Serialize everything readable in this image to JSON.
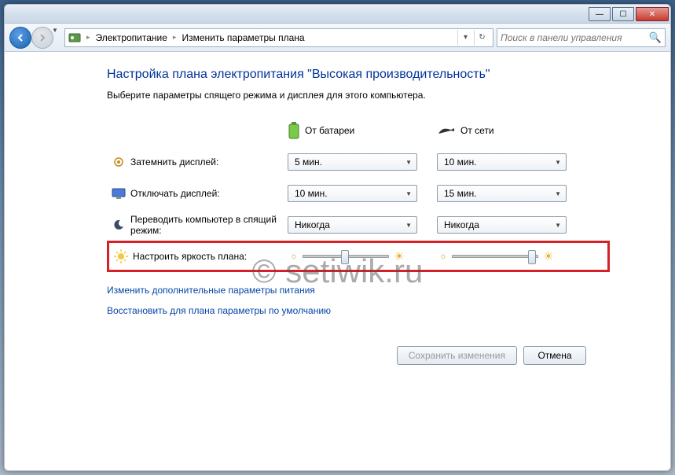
{
  "window_controls": {
    "min": "_",
    "max": "❐",
    "close": "✕"
  },
  "breadcrumbs": {
    "item1": "Электропитание",
    "item2": "Изменить параметры плана"
  },
  "search": {
    "placeholder": "Поиск в панели управления"
  },
  "heading": "Настройка плана электропитания \"Высокая производительность\"",
  "subtext": "Выберите параметры спящего режима и дисплея для этого компьютера.",
  "columns": {
    "battery": "От батареи",
    "plugged": "От сети"
  },
  "rows": {
    "dim": {
      "label": "Затемнить дисплей:",
      "battery": "5 мин.",
      "plugged": "10 мин."
    },
    "off": {
      "label": "Отключать дисплей:",
      "battery": "10 мин.",
      "plugged": "15 мин."
    },
    "sleep": {
      "label": "Переводить компьютер в спящий режим:",
      "battery": "Никогда",
      "plugged": "Никогда"
    },
    "bright": {
      "label": "Настроить яркость плана:"
    }
  },
  "links": {
    "advanced": "Изменить дополнительные параметры питания",
    "restore": "Восстановить для плана параметры по умолчанию"
  },
  "buttons": {
    "save": "Сохранить изменения",
    "cancel": "Отмена"
  },
  "watermark": "© setiwik.ru"
}
